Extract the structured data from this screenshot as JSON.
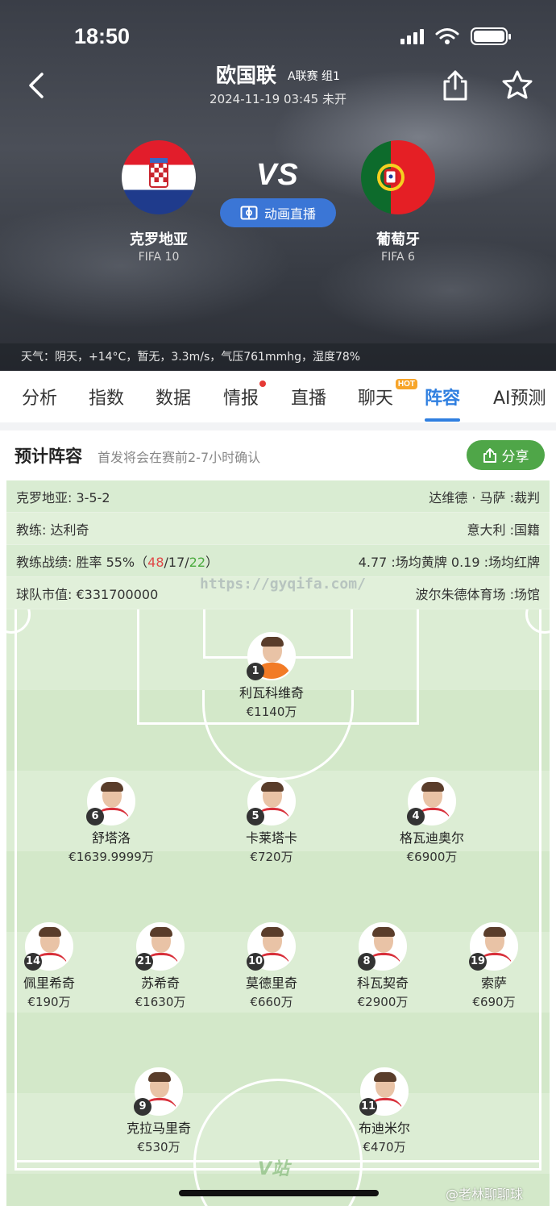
{
  "status_bar": {
    "time": "18:50"
  },
  "header": {
    "title": "欧国联",
    "tag": "A联赛 组1",
    "datetime": "2024-11-19 03:45 未开",
    "vs": "VS",
    "live_button": "动画直播",
    "home": {
      "name": "克罗地亚",
      "fifa": "FIFA 10"
    },
    "away": {
      "name": "葡萄牙",
      "fifa": "FIFA 6"
    },
    "weather": "天气：阴天，+14°C，暂无，3.3m/s，气压761mmhg，湿度78%"
  },
  "tabs": [
    {
      "label": "分析"
    },
    {
      "label": "指数"
    },
    {
      "label": "数据"
    },
    {
      "label": "情报",
      "badge": "dot"
    },
    {
      "label": "直播"
    },
    {
      "label": "聊天",
      "badge": "HOT"
    },
    {
      "label": "阵容",
      "active": true
    },
    {
      "label": "AI预测"
    }
  ],
  "lineup": {
    "title": "预计阵容",
    "subtitle": "首发将会在赛前2-7小时确认",
    "share_label": "分享",
    "formation_left": "克罗地亚: 3-5-2",
    "referee_right": "达维德 · 马萨 :裁判",
    "coach_left": "教练: 达利奇",
    "nationality_right": "意大利 :国籍",
    "record_prefix": "教练战绩: 胜率 55%（",
    "record_win": "48",
    "record_draw": "17",
    "record_loss": "22",
    "record_suffix": "）",
    "cards_right": "4.77 :场均黄牌 0.19 :场均红牌",
    "market_left": "球队市值: €331700000",
    "venue_right": "波尔朱德体育场 :场馆",
    "watermark": "https://gyqifa.com/",
    "slash": "/"
  },
  "players": [
    {
      "number": "1",
      "name": "利瓦科维奇",
      "value": "€1140万",
      "gk": true
    },
    {
      "number": "6",
      "name": "舒塔洛",
      "value": "€1639.9999万"
    },
    {
      "number": "5",
      "name": "卡莱塔卡",
      "value": "€720万"
    },
    {
      "number": "4",
      "name": "格瓦迪奥尔",
      "value": "€6900万"
    },
    {
      "number": "14",
      "name": "佩里希奇",
      "value": "€190万"
    },
    {
      "number": "21",
      "name": "苏希奇",
      "value": "€1630万"
    },
    {
      "number": "10",
      "name": "莫德里奇",
      "value": "€660万"
    },
    {
      "number": "8",
      "name": "科瓦契奇",
      "value": "€2900万"
    },
    {
      "number": "19",
      "name": "索萨",
      "value": "€690万"
    },
    {
      "number": "9",
      "name": "克拉马里奇",
      "value": "€530万"
    },
    {
      "number": "11",
      "name": "布迪米尔",
      "value": "€470万"
    }
  ],
  "overlay": {
    "site_mark": "V站",
    "weibo": "@老林聊聊球"
  }
}
